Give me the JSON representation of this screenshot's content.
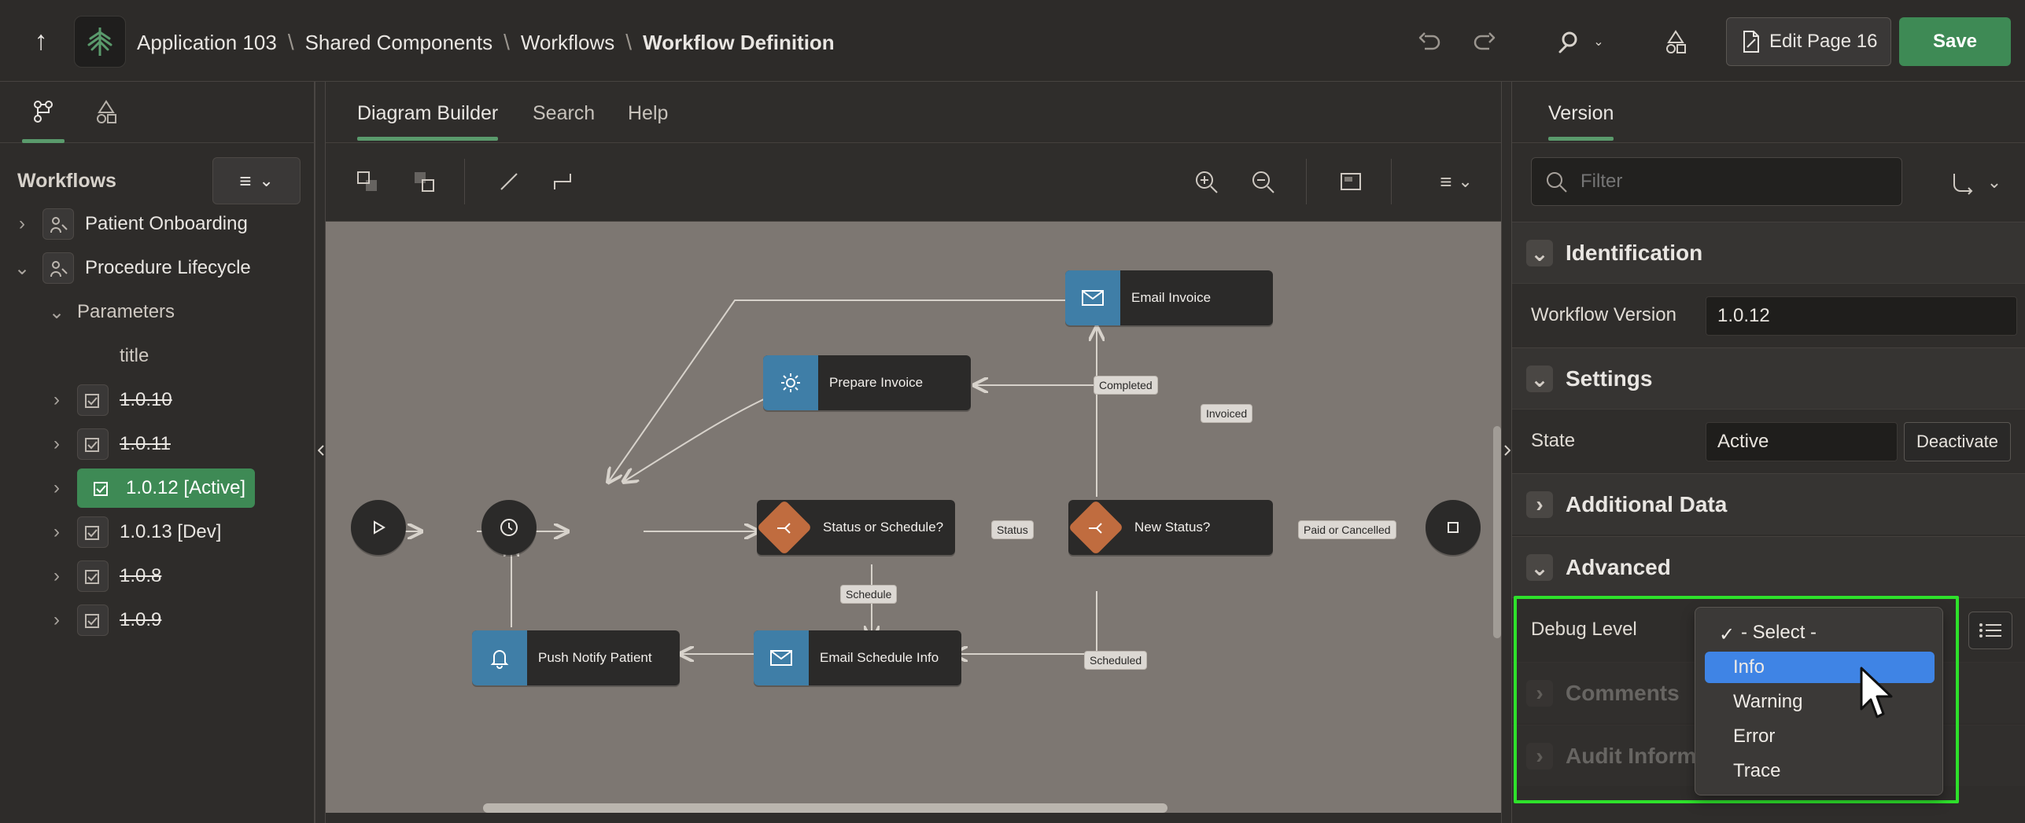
{
  "top": {
    "breadcrumbs": [
      "Application 103",
      "Shared Components",
      "Workflows",
      "Workflow Definition"
    ],
    "edit_page_label": "Edit Page 16",
    "save_label": "Save"
  },
  "left": {
    "workflows_heading": "Workflows",
    "tree": {
      "patient_onboarding": "Patient Onboarding",
      "procedure_lifecycle": "Procedure Lifecycle",
      "parameters": "Parameters",
      "param_title": "title",
      "versions": [
        {
          "label": "1.0.10",
          "strikethrough": true
        },
        {
          "label": "1.0.11",
          "strikethrough": true
        },
        {
          "label": "1.0.12 [Active]",
          "active": true
        },
        {
          "label": "1.0.13 [Dev]"
        },
        {
          "label": "1.0.8",
          "strikethrough": true
        },
        {
          "label": "1.0.9",
          "strikethrough": true
        }
      ]
    }
  },
  "center": {
    "tabs": [
      "Diagram Builder",
      "Search",
      "Help"
    ],
    "nodes": {
      "email_invoice": "Email Invoice",
      "prepare_invoice": "Prepare Invoice",
      "status_or_schedule": "Status or Schedule?",
      "new_status": "New Status?",
      "push_notify": "Push Notify Patient",
      "email_schedule": "Email Schedule Info"
    },
    "labels": {
      "completed": "Completed",
      "invoiced": "Invoiced",
      "status": "Status",
      "paid_or_cancelled": "Paid or Cancelled",
      "schedule": "Schedule",
      "scheduled": "Scheduled"
    }
  },
  "right": {
    "tab": "Version",
    "filter_placeholder": "Filter",
    "sections": {
      "identification": "Identification",
      "settings": "Settings",
      "additional_data": "Additional Data",
      "advanced": "Advanced",
      "comments": "Comments",
      "audit_info": "Audit Inform"
    },
    "fields": {
      "workflow_version_label": "Workflow Version",
      "workflow_version_value": "1.0.12",
      "state_label": "State",
      "state_value": "Active",
      "deactivate": "Deactivate",
      "debug_level_label": "Debug Level"
    },
    "debug_dropdown": {
      "options": [
        "- Select -",
        "Info",
        "Warning",
        "Error",
        "Trace"
      ]
    }
  },
  "colors": {
    "accent_green": "#3e8a55",
    "selection_blue": "#3f84e5",
    "highlight_outline": "#2ee12b",
    "canvas_bg": "#7d7772",
    "node_blue": "#3f7ea7",
    "node_orange": "#c06c3f"
  }
}
